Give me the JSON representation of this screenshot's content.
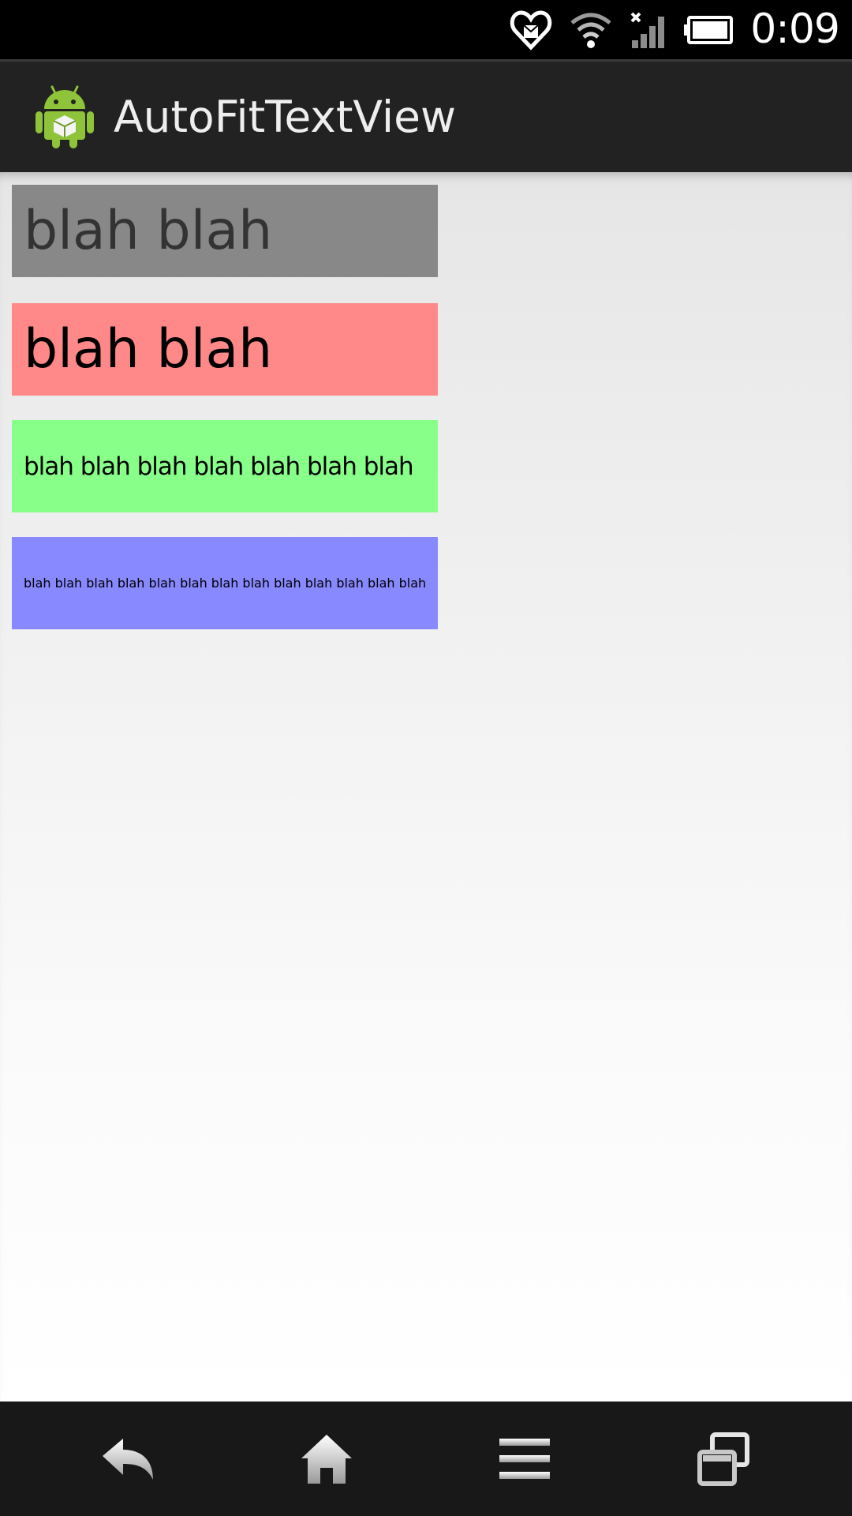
{
  "status_bar": {
    "time": "0:09",
    "icons": [
      "heart-notification-icon",
      "wifi-icon",
      "cell-signal-icon",
      "battery-icon"
    ]
  },
  "action_bar": {
    "title": "AutoFitTextView",
    "logo_icon": "android-app-icon"
  },
  "content": {
    "boxes": [
      {
        "text": "blah blah",
        "background": "#888888",
        "text_color": "#333333"
      },
      {
        "text": "blah blah",
        "background": "#ff8888",
        "text_color": "#000000"
      },
      {
        "text": "blah blah blah blah blah blah blah",
        "background": "#88ff88",
        "text_color": "#000000"
      },
      {
        "text": "blah blah blah blah blah blah blah blah blah blah blah blah blah",
        "background": "#8888ff",
        "text_color": "#000000"
      }
    ]
  },
  "nav_bar": {
    "buttons": [
      {
        "icon": "back-icon"
      },
      {
        "icon": "home-icon"
      },
      {
        "icon": "menu-icon"
      },
      {
        "icon": "recent-apps-icon"
      }
    ]
  }
}
